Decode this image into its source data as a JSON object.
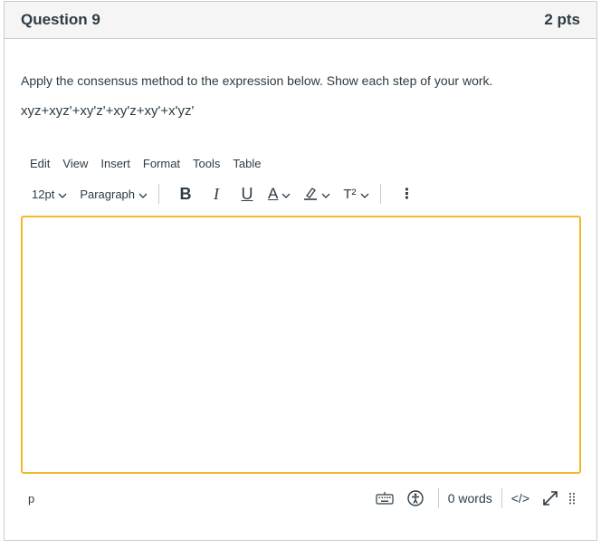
{
  "question": {
    "title": "Question 9",
    "points": "2 pts",
    "prompt": "Apply the consensus method to the expression below. Show each step of your work.",
    "expression": "xyz+xyz'+xy'z'+xy'z+xy'+x'yz'"
  },
  "editor": {
    "menu": [
      "Edit",
      "View",
      "Insert",
      "Format",
      "Tools",
      "Table"
    ],
    "font_size": "12pt",
    "block_format": "Paragraph",
    "bold_label": "B",
    "italic_label": "I",
    "underline_label": "U",
    "text_color_label": "A",
    "superscript_label": "T²",
    "more_label": "⋮",
    "path": "p",
    "word_count": "0 words",
    "html_toggle": "</>",
    "focus_color": "#f5b72a"
  }
}
